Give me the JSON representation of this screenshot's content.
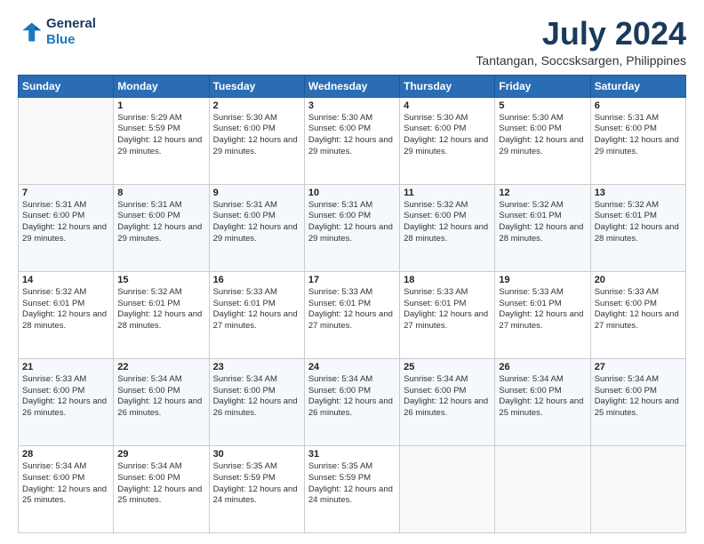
{
  "header": {
    "logo_line1": "General",
    "logo_line2": "Blue",
    "title": "July 2024",
    "subtitle": "Tantangan, Soccsksargen, Philippines"
  },
  "days_header": [
    "Sunday",
    "Monday",
    "Tuesday",
    "Wednesday",
    "Thursday",
    "Friday",
    "Saturday"
  ],
  "weeks": [
    [
      {
        "day": "",
        "info": ""
      },
      {
        "day": "1",
        "info": "Sunrise: 5:29 AM\nSunset: 5:59 PM\nDaylight: 12 hours\nand 29 minutes."
      },
      {
        "day": "2",
        "info": "Sunrise: 5:30 AM\nSunset: 6:00 PM\nDaylight: 12 hours\nand 29 minutes."
      },
      {
        "day": "3",
        "info": "Sunrise: 5:30 AM\nSunset: 6:00 PM\nDaylight: 12 hours\nand 29 minutes."
      },
      {
        "day": "4",
        "info": "Sunrise: 5:30 AM\nSunset: 6:00 PM\nDaylight: 12 hours\nand 29 minutes."
      },
      {
        "day": "5",
        "info": "Sunrise: 5:30 AM\nSunset: 6:00 PM\nDaylight: 12 hours\nand 29 minutes."
      },
      {
        "day": "6",
        "info": "Sunrise: 5:31 AM\nSunset: 6:00 PM\nDaylight: 12 hours\nand 29 minutes."
      }
    ],
    [
      {
        "day": "7",
        "info": "Sunrise: 5:31 AM\nSunset: 6:00 PM\nDaylight: 12 hours\nand 29 minutes."
      },
      {
        "day": "8",
        "info": "Sunrise: 5:31 AM\nSunset: 6:00 PM\nDaylight: 12 hours\nand 29 minutes."
      },
      {
        "day": "9",
        "info": "Sunrise: 5:31 AM\nSunset: 6:00 PM\nDaylight: 12 hours\nand 29 minutes."
      },
      {
        "day": "10",
        "info": "Sunrise: 5:31 AM\nSunset: 6:00 PM\nDaylight: 12 hours\nand 29 minutes."
      },
      {
        "day": "11",
        "info": "Sunrise: 5:32 AM\nSunset: 6:00 PM\nDaylight: 12 hours\nand 28 minutes."
      },
      {
        "day": "12",
        "info": "Sunrise: 5:32 AM\nSunset: 6:01 PM\nDaylight: 12 hours\nand 28 minutes."
      },
      {
        "day": "13",
        "info": "Sunrise: 5:32 AM\nSunset: 6:01 PM\nDaylight: 12 hours\nand 28 minutes."
      }
    ],
    [
      {
        "day": "14",
        "info": "Sunrise: 5:32 AM\nSunset: 6:01 PM\nDaylight: 12 hours\nand 28 minutes."
      },
      {
        "day": "15",
        "info": "Sunrise: 5:32 AM\nSunset: 6:01 PM\nDaylight: 12 hours\nand 28 minutes."
      },
      {
        "day": "16",
        "info": "Sunrise: 5:33 AM\nSunset: 6:01 PM\nDaylight: 12 hours\nand 27 minutes."
      },
      {
        "day": "17",
        "info": "Sunrise: 5:33 AM\nSunset: 6:01 PM\nDaylight: 12 hours\nand 27 minutes."
      },
      {
        "day": "18",
        "info": "Sunrise: 5:33 AM\nSunset: 6:01 PM\nDaylight: 12 hours\nand 27 minutes."
      },
      {
        "day": "19",
        "info": "Sunrise: 5:33 AM\nSunset: 6:01 PM\nDaylight: 12 hours\nand 27 minutes."
      },
      {
        "day": "20",
        "info": "Sunrise: 5:33 AM\nSunset: 6:00 PM\nDaylight: 12 hours\nand 27 minutes."
      }
    ],
    [
      {
        "day": "21",
        "info": "Sunrise: 5:33 AM\nSunset: 6:00 PM\nDaylight: 12 hours\nand 26 minutes."
      },
      {
        "day": "22",
        "info": "Sunrise: 5:34 AM\nSunset: 6:00 PM\nDaylight: 12 hours\nand 26 minutes."
      },
      {
        "day": "23",
        "info": "Sunrise: 5:34 AM\nSunset: 6:00 PM\nDaylight: 12 hours\nand 26 minutes."
      },
      {
        "day": "24",
        "info": "Sunrise: 5:34 AM\nSunset: 6:00 PM\nDaylight: 12 hours\nand 26 minutes."
      },
      {
        "day": "25",
        "info": "Sunrise: 5:34 AM\nSunset: 6:00 PM\nDaylight: 12 hours\nand 26 minutes."
      },
      {
        "day": "26",
        "info": "Sunrise: 5:34 AM\nSunset: 6:00 PM\nDaylight: 12 hours\nand 25 minutes."
      },
      {
        "day": "27",
        "info": "Sunrise: 5:34 AM\nSunset: 6:00 PM\nDaylight: 12 hours\nand 25 minutes."
      }
    ],
    [
      {
        "day": "28",
        "info": "Sunrise: 5:34 AM\nSunset: 6:00 PM\nDaylight: 12 hours\nand 25 minutes."
      },
      {
        "day": "29",
        "info": "Sunrise: 5:34 AM\nSunset: 6:00 PM\nDaylight: 12 hours\nand 25 minutes."
      },
      {
        "day": "30",
        "info": "Sunrise: 5:35 AM\nSunset: 5:59 PM\nDaylight: 12 hours\nand 24 minutes."
      },
      {
        "day": "31",
        "info": "Sunrise: 5:35 AM\nSunset: 5:59 PM\nDaylight: 12 hours\nand 24 minutes."
      },
      {
        "day": "",
        "info": ""
      },
      {
        "day": "",
        "info": ""
      },
      {
        "day": "",
        "info": ""
      }
    ]
  ]
}
